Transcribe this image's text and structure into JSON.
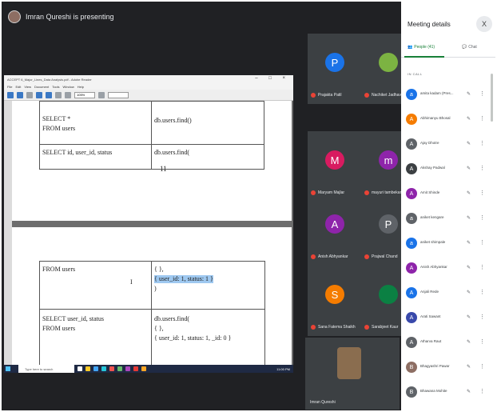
{
  "presenter": {
    "text": "Imran Qureshi is presenting"
  },
  "app_window": {
    "title": "ACCEPT 6_Major_Lines_Data Analysis.pdf - Adobe Reader",
    "menu": [
      "File",
      "Edit",
      "View",
      "Document",
      "Tools",
      "Window",
      "Help"
    ],
    "zoom": "105%",
    "page1": {
      "row1_left": [
        "SELECT *",
        "FROM users"
      ],
      "row1_right": "db.users.find()",
      "row2_left": "SELECT id, user_id, status",
      "row2_right": "db.users.find(",
      "page_number": "11"
    },
    "page2": {
      "left_top": "FROM users",
      "right_top": [
        "{ },",
        "{ user_id: 1, status: 1 }",
        ")"
      ],
      "cursor": "I",
      "left_bottom": [
        "SELECT user_id, status",
        "FROM users"
      ],
      "right_bottom": [
        "db.users.find(",
        "{ },",
        "{ user_id: 1, status: 1, _id: 0 }"
      ]
    }
  },
  "taskbar": {
    "search_placeholder": "Type here to search",
    "clock": "11:00 PM"
  },
  "tiles": [
    {
      "initial": "P",
      "name": "Prajakta Patil",
      "color": "#1a73e8"
    },
    {
      "initial": "",
      "name": "Nachiket Jadhav",
      "color": "#7cb342"
    },
    {
      "initial": "M",
      "name": "Maryam Majlar",
      "color": "#d81b60"
    },
    {
      "initial": "m",
      "name": "mayuri tambekar",
      "color": "#8e24aa"
    },
    {
      "initial": "A",
      "name": "Anish Abhyankar",
      "color": "#8e24aa"
    },
    {
      "initial": "P",
      "name": "Prajwal Chand",
      "color": "#5f6368"
    },
    {
      "initial": "S",
      "name": "Sana Fatema Shaikh",
      "color": "#f57c00"
    },
    {
      "initial": "",
      "name": "Sarabjeet Kaur",
      "color": "#0b8043"
    }
  ],
  "self_tile": {
    "name": "Imran Qureshi"
  },
  "panel": {
    "title": "Meeting details",
    "close": "X",
    "tab_people": "People (41)",
    "tab_chat": "Chat",
    "section_label": "IN CALL",
    "participants": [
      {
        "initial": "a",
        "name": "amita kadam (Pres...",
        "color": "#1a73e8"
      },
      {
        "initial": "A",
        "name": "Abhimanyu Bhosal",
        "color": "#f57c00"
      },
      {
        "initial": "A",
        "name": "Ajay Dhotre",
        "color": "#5f6368"
      },
      {
        "initial": "A",
        "name": "Akshay Padwal",
        "color": "#3c4043"
      },
      {
        "initial": "A",
        "name": "Amit Shinde",
        "color": "#8e24aa"
      },
      {
        "initial": "a",
        "name": "aniket kengare",
        "color": "#5f6368"
      },
      {
        "initial": "a",
        "name": "aniket shimpale",
        "color": "#1a73e8"
      },
      {
        "initial": "A",
        "name": "Anish Abhyankar",
        "color": "#8e24aa"
      },
      {
        "initial": "A",
        "name": "Anjali Rede",
        "color": "#1a73e8"
      },
      {
        "initial": "A",
        "name": "Arati Sawant",
        "color": "#3949ab"
      },
      {
        "initial": "A",
        "name": "Atharva Raut",
        "color": "#5f6368"
      },
      {
        "initial": "B",
        "name": "Bhagyashri Pawar",
        "color": "#8d6e63"
      },
      {
        "initial": "B",
        "name": "Bhawana Mohite",
        "color": "#5f6368"
      }
    ]
  }
}
